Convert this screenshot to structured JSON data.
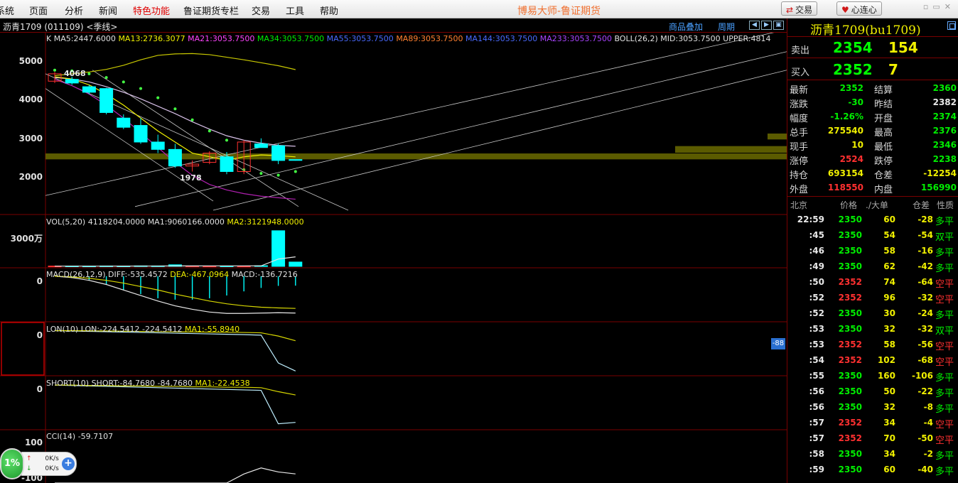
{
  "menu": {
    "items": [
      "系统",
      "页面",
      "分析",
      "新闻",
      "特色功能",
      "鲁证期货专栏",
      "交易",
      "工具",
      "帮助"
    ],
    "app_title": "博易大师-鲁证期货",
    "trade_button": "交易",
    "heart_button": "心连心"
  },
  "chart_header": {
    "symbol": "沥青1709 (011109) <季线>",
    "overlay_link": "商品叠加",
    "period_link": "周期"
  },
  "legends": {
    "k_prefix": "K",
    "ma5": "MA5:2447.6000",
    "ma13": "MA13:2736.3077",
    "ma21": "MA21:3053.7500",
    "ma34": "MA34:3053.7500",
    "ma55": "MA55:3053.7500",
    "ma89": "MA89:3053.7500",
    "ma144": "MA144:3053.7500",
    "ma233": "MA233:3053.7500",
    "boll": "BOLL(26,2) MID:3053.7500 UPPER:4814",
    "vol_name": "VOL(5,20)",
    "vol_value": "4118204.0000",
    "vol_ma1": "MA1:9060166.0000",
    "vol_ma2": "MA2:3121948.0000",
    "macd_name": "MACD(26,12,9)",
    "macd_diff": "DIFF:-535.4572",
    "macd_dea": "DEA:-467.0964",
    "macd_val": "MACD:-136.7216",
    "lon_name": "LON(10)",
    "lon_value": "LON:-224.5412 -224.5412",
    "lon_ma1": "MA1:-55.8940",
    "short_name": "SHORT(10)",
    "short_value": "SHORT:-84.7680 -84.7680",
    "short_ma1": "MA1:-22.4538",
    "cci_name": "CCI(14)",
    "cci_value": "-59.7107"
  },
  "axes": {
    "price_ticks": [
      "5000",
      "4000",
      "3000",
      "2000"
    ],
    "vol_tick": "3000万",
    "macd_zero": "0",
    "lon_zero": "0",
    "short_zero": "0",
    "cci_top": "100",
    "cci_bottom": "-100"
  },
  "annotations": {
    "high_label": "4068",
    "low_label": "1978",
    "lon_badge": "-88"
  },
  "chart_data": [
    {
      "type": "candlestick",
      "title": "沥青1709 季线",
      "candles": [
        {
          "o": 4500,
          "h": 4750,
          "l": 4450,
          "c": 4700
        },
        {
          "o": 4550,
          "h": 4620,
          "l": 4400,
          "c": 4450
        },
        {
          "o": 4350,
          "h": 4400,
          "l": 4150,
          "c": 4200
        },
        {
          "o": 4300,
          "h": 4320,
          "l": 3600,
          "c": 3650
        },
        {
          "o": 3500,
          "h": 3600,
          "l": 3200,
          "c": 3250
        },
        {
          "o": 3300,
          "h": 3500,
          "l": 2800,
          "c": 2850
        },
        {
          "o": 2850,
          "h": 3050,
          "l": 2550,
          "c": 2650
        },
        {
          "o": 2650,
          "h": 2800,
          "l": 2150,
          "c": 2200
        },
        {
          "o": 2200,
          "h": 2350,
          "l": 2050,
          "c": 2250
        },
        {
          "o": 2300,
          "h": 2600,
          "l": 2250,
          "c": 2550
        },
        {
          "o": 2450,
          "h": 2580,
          "l": 1978,
          "c": 2050
        },
        {
          "o": 2050,
          "h": 2900,
          "l": 1980,
          "c": 2850
        },
        {
          "o": 2800,
          "h": 2950,
          "l": 2700,
          "c": 2700
        },
        {
          "o": 2750,
          "h": 2800,
          "l": 2250,
          "c": 2350
        },
        {
          "o": 2374,
          "h": 2376,
          "l": 2346,
          "c": 2352
        }
      ],
      "ylim": [
        1000,
        5700
      ],
      "ma5": [
        4620,
        4560,
        4400,
        4150,
        3850,
        3500,
        3150,
        2850,
        2550,
        2450,
        2350,
        2450,
        2500,
        2480,
        2448
      ],
      "ma13": [
        4600,
        4560,
        4480,
        4350,
        4200,
        4020,
        3820,
        3620,
        3400,
        3200,
        3020,
        2900,
        2820,
        2760,
        2736
      ],
      "boll_upper": [
        4650,
        4700,
        4750,
        4820,
        4930,
        5080,
        5200,
        5240,
        5250,
        5220,
        5150,
        5080,
        5000,
        4920,
        4814
      ],
      "boll_lower": [
        4550,
        4380,
        4150,
        3850,
        3500,
        3100,
        2700,
        2300,
        1950,
        1700,
        1550,
        1450,
        1380,
        1340,
        1300
      ],
      "sar": [
        4800,
        4780,
        4700,
        4600,
        4480,
        4300,
        4050,
        3750,
        3450,
        3150,
        2900,
        2100,
        2000,
        1950,
        2050
      ]
    },
    {
      "type": "bar",
      "title": "VOL",
      "values": [
        300000,
        350000,
        300000,
        400000,
        350000,
        500000,
        450000,
        1500000,
        400000,
        300000,
        350000,
        300000,
        600000,
        34000000,
        4118204
      ],
      "ma1": [
        200000,
        200000,
        200000,
        200000,
        250000,
        300000,
        300000,
        400000,
        400000,
        450000,
        450000,
        450000,
        500000,
        7000000,
        9060166
      ],
      "ylim": [
        0,
        40000000
      ]
    },
    {
      "type": "bar",
      "title": "MACD",
      "diff": [
        0,
        -20,
        -60,
        -120,
        -200,
        -280,
        -360,
        -430,
        -480,
        -520,
        -540,
        -540,
        -535,
        -530,
        -535
      ],
      "dea": [
        0,
        -10,
        -30,
        -60,
        -100,
        -150,
        -200,
        -260,
        -310,
        -360,
        -400,
        -430,
        -450,
        -460,
        -467
      ],
      "macd": [
        0,
        -20,
        -60,
        -120,
        -200,
        -260,
        -320,
        -340,
        -340,
        -320,
        -280,
        -220,
        -170,
        -140,
        -137
      ],
      "ylim": [
        -620,
        40
      ]
    },
    {
      "type": "line",
      "title": "LON",
      "lon": [
        0,
        -2,
        -4,
        -6,
        -8,
        -10,
        -12,
        -14,
        -16,
        -18,
        -20,
        -22,
        -25,
        -180,
        -224.5
      ],
      "ma1": [
        0,
        0,
        -1,
        -2,
        -3,
        -4,
        -5,
        -6,
        -7,
        -8,
        -9,
        -10,
        -12,
        -30,
        -55.9
      ],
      "ylim": [
        -235,
        10
      ]
    },
    {
      "type": "line",
      "title": "SHORT",
      "short": [
        0,
        -1,
        -2,
        -3,
        -4,
        -5,
        -6,
        -7,
        -8,
        -9,
        -10,
        -11,
        -12,
        -88,
        -84.8
      ],
      "ma1": [
        0,
        0,
        -1,
        -1,
        -2,
        -2,
        -3,
        -3,
        -4,
        -4,
        -5,
        -5,
        -6,
        -15,
        -22.5
      ],
      "ylim": [
        -95,
        5
      ]
    },
    {
      "type": "line",
      "title": "CCI",
      "cci": [
        -120,
        -130,
        -135,
        -140,
        -145,
        -150,
        -160,
        -160,
        -150,
        -140,
        -110,
        -60,
        -30,
        -50,
        -59.7
      ],
      "ylim": [
        -105,
        125
      ]
    }
  ],
  "quote": {
    "title": "沥青1709(bu1709)",
    "ask_label": "卖出",
    "ask_price": "2354",
    "ask_vol": "154",
    "bid_label": "买入",
    "bid_price": "2352",
    "bid_vol": "7",
    "stats": [
      {
        "l1": "最新",
        "v1": "2352",
        "c1": "green",
        "l2": "结算",
        "v2": "2360",
        "c2": "green"
      },
      {
        "l1": "涨跌",
        "v1": "-30",
        "c1": "green",
        "l2": "昨结",
        "v2": "2382",
        "c2": "white"
      },
      {
        "l1": "幅度",
        "v1": "-1.26%",
        "c1": "green",
        "l2": "开盘",
        "v2": "2374",
        "c2": "green"
      },
      {
        "l1": "总手",
        "v1": "275540",
        "c1": "yellow",
        "l2": "最高",
        "v2": "2376",
        "c2": "green"
      },
      {
        "l1": "现手",
        "v1": "10",
        "c1": "yellow",
        "l2": "最低",
        "v2": "2346",
        "c2": "green"
      },
      {
        "l1": "涨停",
        "v1": "2524",
        "c1": "red",
        "l2": "跌停",
        "v2": "2238",
        "c2": "green"
      },
      {
        "l1": "持仓",
        "v1": "693154",
        "c1": "yellow",
        "l2": "仓差",
        "v2": "-12254",
        "c2": "yellow"
      },
      {
        "l1": "外盘",
        "v1": "118550",
        "c1": "red",
        "l2": "内盘",
        "v2": "156990",
        "c2": "green"
      }
    ],
    "tick_header": {
      "time": "北京",
      "price": "价格",
      "vol": "./大单",
      "chg": "仓差",
      "nature": "性质"
    },
    "ticks": [
      {
        "time": "22:59",
        "price": "2350",
        "pc": "green",
        "vol": "60",
        "chg": "-28",
        "cc": "yellow",
        "nature": "多平",
        "nc": "green"
      },
      {
        "time": ":45",
        "price": "2350",
        "pc": "green",
        "vol": "54",
        "chg": "-54",
        "cc": "yellow",
        "nature": "双平",
        "nc": "green"
      },
      {
        "time": ":46",
        "price": "2350",
        "pc": "green",
        "vol": "58",
        "chg": "-16",
        "cc": "yellow",
        "nature": "多平",
        "nc": "green"
      },
      {
        "time": ":49",
        "price": "2350",
        "pc": "green",
        "vol": "62",
        "chg": "-42",
        "cc": "yellow",
        "nature": "多平",
        "nc": "green"
      },
      {
        "time": ":50",
        "price": "2352",
        "pc": "red",
        "vol": "74",
        "chg": "-64",
        "cc": "yellow",
        "nature": "空平",
        "nc": "red"
      },
      {
        "time": ":52",
        "price": "2352",
        "pc": "red",
        "vol": "96",
        "chg": "-32",
        "cc": "yellow",
        "nature": "空平",
        "nc": "red"
      },
      {
        "time": ":52",
        "price": "2350",
        "pc": "green",
        "vol": "30",
        "chg": "-24",
        "cc": "yellow",
        "nature": "多平",
        "nc": "green"
      },
      {
        "time": ":53",
        "price": "2350",
        "pc": "green",
        "vol": "32",
        "chg": "-32",
        "cc": "yellow",
        "nature": "双平",
        "nc": "green"
      },
      {
        "time": ":53",
        "price": "2352",
        "pc": "red",
        "vol": "58",
        "chg": "-56",
        "cc": "yellow",
        "nature": "空平",
        "nc": "red"
      },
      {
        "time": ":54",
        "price": "2352",
        "pc": "red",
        "vol": "102",
        "chg": "-68",
        "cc": "yellow",
        "nature": "空平",
        "nc": "red"
      },
      {
        "time": ":55",
        "price": "2350",
        "pc": "green",
        "vol": "160",
        "chg": "-106",
        "cc": "yellow",
        "nature": "多平",
        "nc": "green"
      },
      {
        "time": ":56",
        "price": "2350",
        "pc": "green",
        "vol": "50",
        "chg": "-22",
        "cc": "yellow",
        "nature": "多平",
        "nc": "green"
      },
      {
        "time": ":56",
        "price": "2350",
        "pc": "green",
        "vol": "32",
        "chg": "-8",
        "cc": "yellow",
        "nature": "多平",
        "nc": "green"
      },
      {
        "time": ":57",
        "price": "2352",
        "pc": "red",
        "vol": "34",
        "chg": "-4",
        "cc": "yellow",
        "nature": "空平",
        "nc": "red"
      },
      {
        "time": ":57",
        "price": "2352",
        "pc": "red",
        "vol": "70",
        "chg": "-50",
        "cc": "yellow",
        "nature": "空平",
        "nc": "red"
      },
      {
        "time": ":58",
        "price": "2350",
        "pc": "green",
        "vol": "34",
        "chg": "-2",
        "cc": "yellow",
        "nature": "多平",
        "nc": "green"
      },
      {
        "time": ":59",
        "price": "2350",
        "pc": "green",
        "vol": "60",
        "chg": "-40",
        "cc": "yellow",
        "nature": "多平",
        "nc": "green"
      }
    ]
  },
  "net_widget": {
    "percent": "1%",
    "up_speed": "0K/s",
    "down_speed": "0K/s"
  },
  "colors": {
    "up": "#ff3030",
    "down": "#00ffff",
    "grid": "#7a0000",
    "accent_yellow": "#f0f000"
  }
}
